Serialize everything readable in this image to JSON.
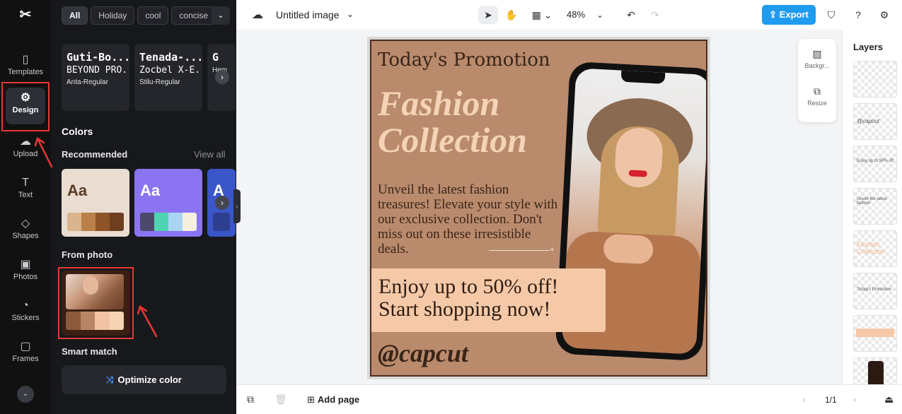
{
  "rail": {
    "logo": "✂",
    "items": [
      {
        "label": "Templates",
        "icon": "▯"
      },
      {
        "label": "Design",
        "icon": "⚙"
      },
      {
        "label": "Upload",
        "icon": "☁"
      },
      {
        "label": "Text",
        "icon": "T"
      },
      {
        "label": "Shapes",
        "icon": "◇"
      },
      {
        "label": "Photos",
        "icon": "▣"
      },
      {
        "label": "Stickers",
        "icon": "◔"
      },
      {
        "label": "Frames",
        "icon": "▢"
      }
    ],
    "more_icon": "⌄"
  },
  "panel": {
    "chips": [
      "All",
      "Holiday",
      "cool",
      "concise"
    ],
    "chip_more": "⌄",
    "fonts": [
      {
        "line1": "Guti-Bo...",
        "line2": "BEYOND PRO...",
        "line3": "Anta-Regular"
      },
      {
        "line1": "Tenada-...",
        "line2": "Zocbel X-E...",
        "line3": "Stilu-Regular"
      },
      {
        "line1": "G",
        "line2": "",
        "line3": "Hem"
      }
    ],
    "colors_title": "Colors",
    "recommended_label": "Recommended",
    "view_all": "View all",
    "palettes": [
      {
        "aa": "Aa",
        "bg": "#e9dcd0",
        "text": "#5a3a24",
        "swatches": [
          "#d9b48c",
          "#b98049",
          "#8c5427",
          "#6d3f1f"
        ]
      },
      {
        "aa": "Aa",
        "bg": "#8a74f2",
        "text": "#ffffff",
        "swatches": [
          "#4b4a6b",
          "#4fd4b2",
          "#a9d5f3",
          "#f5efde"
        ]
      },
      {
        "aa": "A",
        "bg": "#3b56c9",
        "text": "#ffffff",
        "swatches": [
          "#2d3f8f"
        ]
      }
    ],
    "from_photo_label": "From photo",
    "photo_swatches": [
      "#8c5a3c",
      "#b98665",
      "#f0c3a4",
      "#f6d3b3"
    ],
    "smart_match_label": "Smart match",
    "optimize_label": "Optimize color",
    "optimize_icon": "⤨"
  },
  "topbar": {
    "doc_title": "Untitled image",
    "zoom": "48%",
    "export_label": "Export",
    "export_icon": "⇪"
  },
  "side_tools": {
    "background_label": "Backgr...",
    "resize_label": "Resize"
  },
  "layers": {
    "title": "Layers",
    "thumb_texts": [
      "",
      "@capcut",
      "Enjoy up to 50% off",
      "Unveil the latest fashion",
      "Fashion Collection",
      "Today's Promotion",
      "",
      ""
    ]
  },
  "poster": {
    "heading": "Today's Promotion",
    "title_line1": "Fashion",
    "title_line2": "Collection",
    "body": "Unveil the latest fashion treasures! Elevate your style with our exclusive collection. Don't miss out on these irresistible deals.",
    "promo_line1": "Enjoy up to 50% off!",
    "promo_line2": "Start shopping now!",
    "handle": "@capcut",
    "colors": {
      "background": "#b98a6c",
      "title": "#f4d3b6",
      "promo_box": "#f5c9a8",
      "text": "#3a2418"
    }
  },
  "bottombar": {
    "add_page_label": "Add page",
    "page_indicator": "1/1"
  }
}
